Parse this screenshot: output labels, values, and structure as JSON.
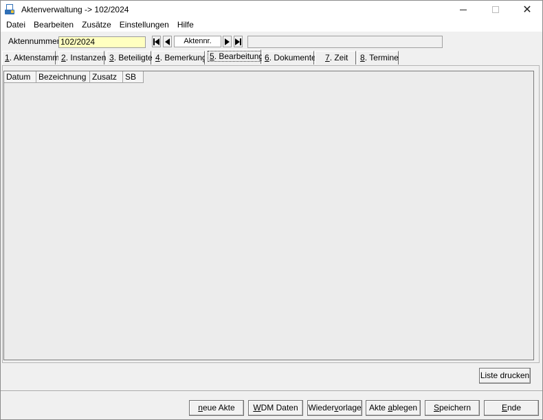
{
  "window": {
    "title": "Aktenverwaltung -> 102/2024",
    "icon": "app-document-icon"
  },
  "menu": [
    "Datei",
    "Bearbeiten",
    "Zusätze",
    "Einstellungen",
    "Hilfe"
  ],
  "toolbar": {
    "aktennummer_label": "Aktennummer :",
    "aktennummer_value": "102/2024",
    "nav_label": "Aktennr.",
    "status_value": ""
  },
  "tabs": [
    {
      "key": "1",
      "label": ". Aktenstamm"
    },
    {
      "key": "2",
      "label": ". Instanzen"
    },
    {
      "key": "3",
      "label": ". Beteiligte"
    },
    {
      "key": "4",
      "label": ". Bemerkung"
    },
    {
      "key": "5",
      "label": ". Bearbeitung"
    },
    {
      "key": "6",
      "label": ". Dokumente"
    },
    {
      "key": "7",
      "label": ". Zeit"
    },
    {
      "key": "8",
      "label": ". Termine"
    }
  ],
  "active_tab": "5. Bearbeitung",
  "list": {
    "columns": [
      "Datum",
      "Bezeichnung",
      "Zusatz",
      "SB"
    ]
  },
  "buttons": {
    "liste_drucken": "Liste drucken",
    "neue_akte": {
      "pre": "",
      "u": "n",
      "post": "eue Akte"
    },
    "wdm_daten": {
      "pre": "",
      "u": "W",
      "post": "DM Daten"
    },
    "wiedervorlage": {
      "pre": "Wieder",
      "u": "v",
      "post": "orlage"
    },
    "akte_ablegen": {
      "pre": "Akte ",
      "u": "a",
      "post": "blegen"
    },
    "speichern": {
      "pre": "",
      "u": "S",
      "post": "peichern"
    },
    "ende": {
      "pre": "",
      "u": "E",
      "post": "nde"
    }
  },
  "colors": {
    "input_bg": "#ffffc0",
    "window_bg": "#f0f0f0"
  }
}
